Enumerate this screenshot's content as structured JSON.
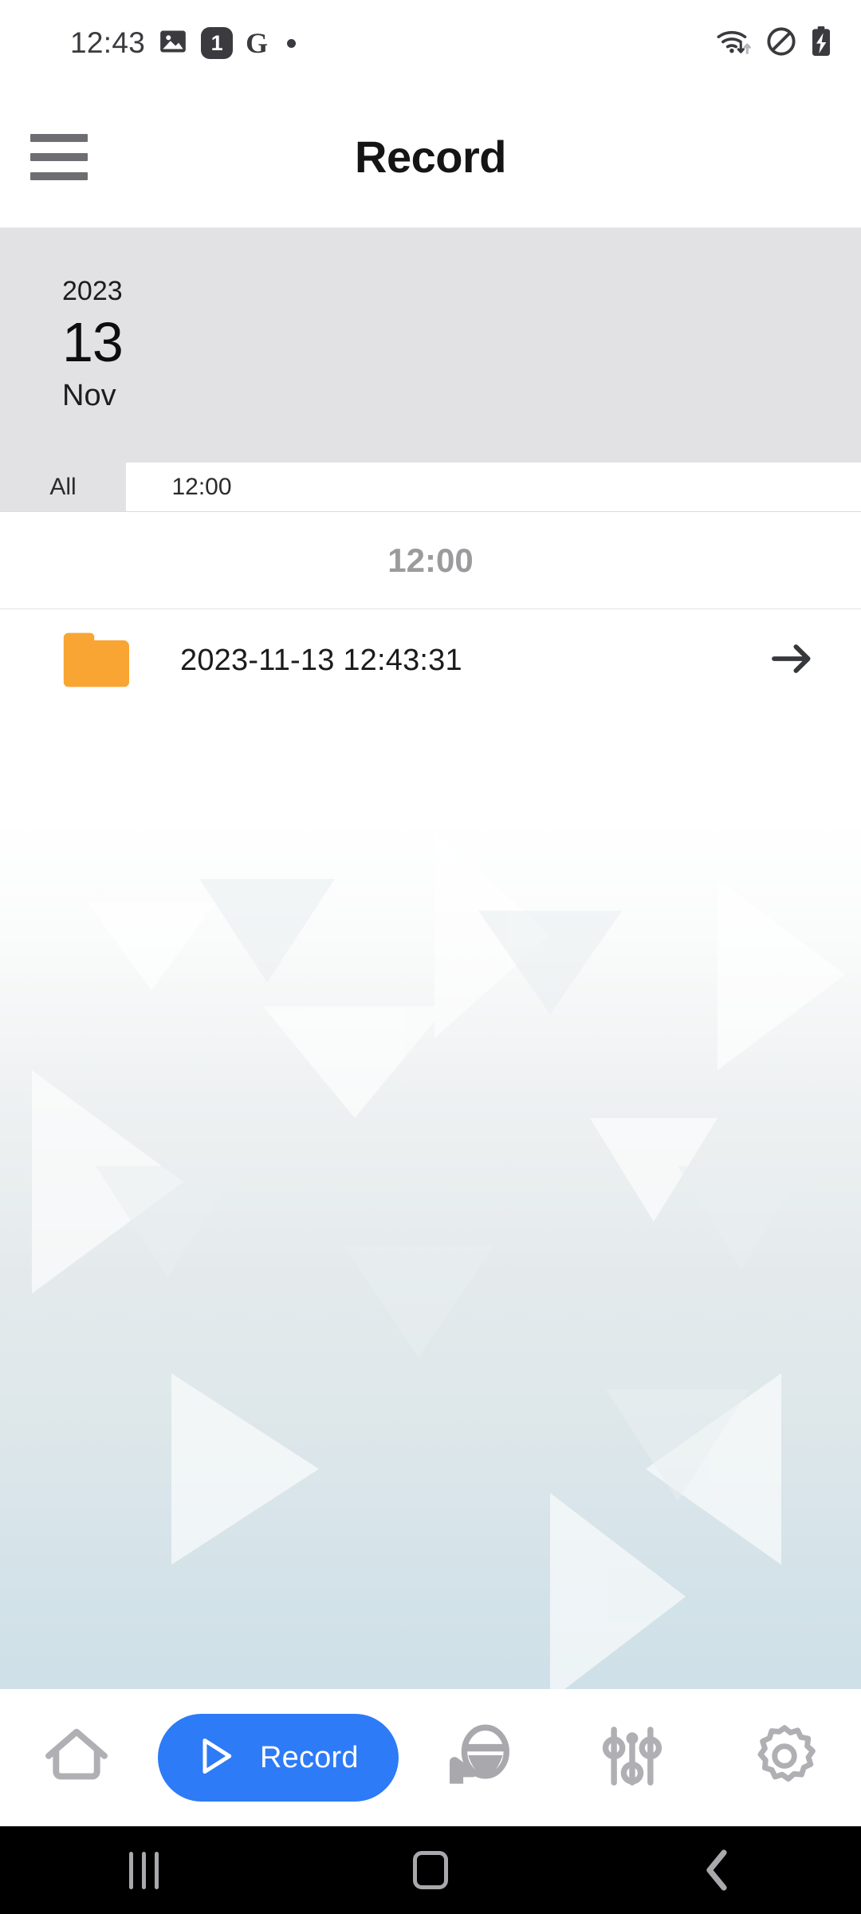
{
  "status_bar": {
    "clock": "12:43",
    "badge_count": "1",
    "google_letter": "G",
    "icons": [
      "photo-icon",
      "notification-count-badge",
      "google-icon",
      "dot-icon",
      "wifi-icon",
      "do-not-disturb-icon",
      "battery-charging-icon"
    ]
  },
  "app_bar": {
    "title": "Record",
    "menu_icon": "hamburger-menu-icon"
  },
  "date_panel": {
    "year": "2023",
    "day": "13",
    "month": "Nov"
  },
  "tabs": [
    {
      "label": "All",
      "selected": true
    },
    {
      "label": "12:00",
      "selected": false
    }
  ],
  "section": {
    "header": "12:00"
  },
  "records": [
    {
      "icon": "folder-icon",
      "label": "2023-11-13 12:43:31",
      "arrow": "arrow-right-icon"
    }
  ],
  "bottom_nav": [
    {
      "name": "home",
      "icon": "home-icon",
      "label": ""
    },
    {
      "name": "record",
      "icon": "play-icon",
      "label": "Record",
      "active": true
    },
    {
      "name": "driving",
      "icon": "steering-wheel-icon",
      "label": ""
    },
    {
      "name": "tuning",
      "icon": "sliders-icon",
      "label": ""
    },
    {
      "name": "settings",
      "icon": "gear-icon",
      "label": ""
    }
  ],
  "system_nav": [
    {
      "name": "recents",
      "icon": "recents-icon"
    },
    {
      "name": "home",
      "icon": "home-square-icon"
    },
    {
      "name": "back",
      "icon": "back-chevron-icon"
    }
  ],
  "colors": {
    "accent_blue": "#2d7bf6",
    "folder_orange": "#f9a533",
    "panel_gray": "#e2e2e4",
    "section_text_gray": "#9b9b9e",
    "icon_gray": "#b0b0b4",
    "title_black": "#151515"
  }
}
